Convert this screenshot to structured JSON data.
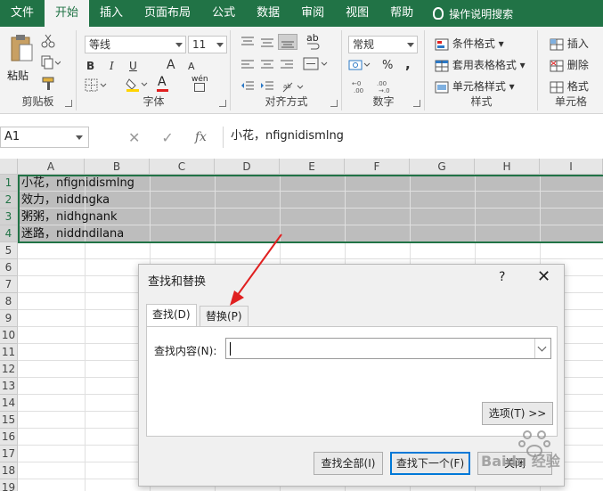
{
  "tabs": [
    "文件",
    "开始",
    "插入",
    "页面布局",
    "公式",
    "数据",
    "审阅",
    "视图",
    "帮助"
  ],
  "tell_me": "操作说明搜索",
  "ribbon": {
    "clipboard": {
      "label": "剪贴板",
      "paste": "粘贴"
    },
    "font": {
      "label": "字体",
      "font_name": "等线",
      "font_size": "11",
      "bold": "B",
      "italic": "I",
      "underline": "U",
      "grow": "A",
      "shrink": "A",
      "font_color_glyph": "A",
      "pinyin": "wén"
    },
    "alignment": {
      "label": "对齐方式",
      "wrap_glyph": "ab"
    },
    "number": {
      "label": "数字",
      "format": "常规",
      "percent": "%",
      "comma": ","
    },
    "styles": {
      "label": "样式",
      "cond_format": "条件格式",
      "table_format": "套用表格格式",
      "cell_styles": "单元格样式"
    },
    "cells": {
      "label": "单元格",
      "insert": "插入",
      "delete": "删除",
      "format": "格式"
    }
  },
  "formula_bar": {
    "name_box": "A1",
    "cancel": "✕",
    "enter": "✓",
    "fx": "fx",
    "content": "小花，nfignidismlng"
  },
  "columns": [
    "A",
    "B",
    "C",
    "D",
    "E",
    "F",
    "G",
    "H",
    "I"
  ],
  "rows": [
    "1",
    "2",
    "3",
    "4",
    "5",
    "6",
    "7",
    "8",
    "9",
    "10",
    "11",
    "12",
    "13",
    "14",
    "15",
    "16",
    "17",
    "18",
    "19"
  ],
  "cells": [
    "小花，nfignidismlng",
    "效力，niddngka",
    "粥粥，nidhgnank",
    "迷路，niddndilana"
  ],
  "dialog": {
    "title": "查找和替换",
    "help": "?",
    "close": "✕",
    "tab_find": "查找(D)",
    "tab_replace": "替换(P)",
    "find_label": "查找内容(N):",
    "find_value": "",
    "options_button": "选项(T) >>",
    "find_all": "查找全部(I)",
    "find_next": "查找下一个(F)",
    "close_button": "关闭"
  },
  "watermark": "Baidu 经验",
  "colors": {
    "excel_green": "#217346",
    "arrow_red": "#e02020",
    "dialog_primary": "#0078d7"
  }
}
